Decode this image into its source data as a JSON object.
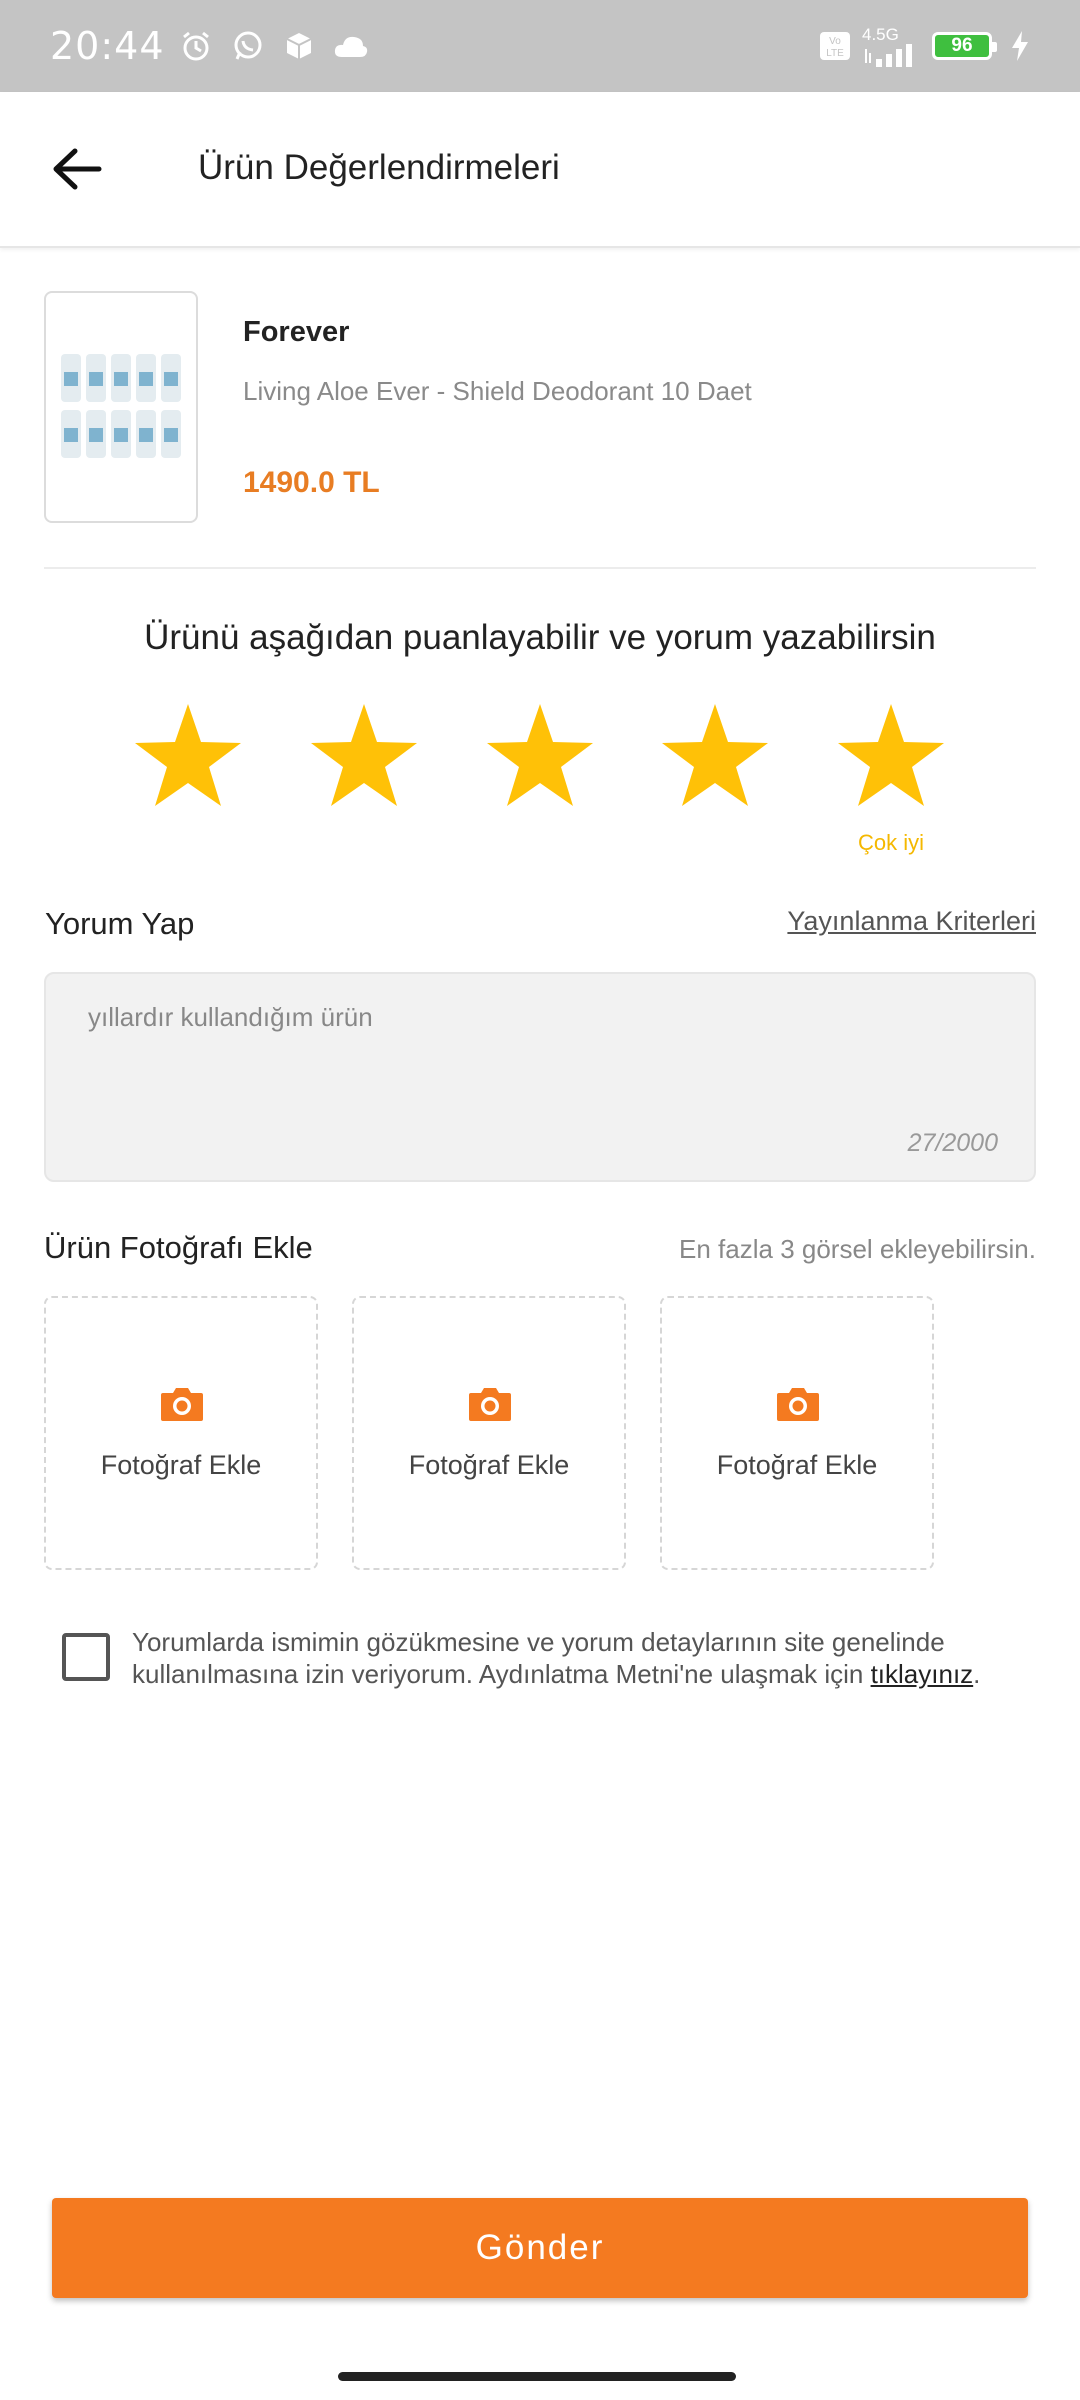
{
  "status_bar": {
    "time": "20:44",
    "network_label": "4.5G",
    "volte_label": "Vo\nLTE",
    "battery": "96",
    "icons": [
      "alarm-icon",
      "whatsapp-icon",
      "package-icon",
      "cloud-icon",
      "volte-icon",
      "signal-icon",
      "battery-icon",
      "charging-icon"
    ]
  },
  "app_bar": {
    "title": "Ürün Değerlendirmeleri",
    "back_icon": "back-arrow-icon"
  },
  "product": {
    "brand": "Forever",
    "name": "Living Aloe Ever - Shield Deodorant 10 Daet",
    "price": "1490.0 TL"
  },
  "rating": {
    "prompt": "Ürünü aşağıdan puanlayabilir ve yorum yazabilirsin",
    "value": 5,
    "max": 5,
    "label": "Çok iyi",
    "star_color": "#FFC107"
  },
  "comment": {
    "title": "Yorum Yap",
    "criteria_link": "Yayınlanma Kriterleri",
    "text": "yıllardır kullandığım ürün",
    "counter": "27/2000"
  },
  "photos": {
    "title": "Ürün Fotoğrafı Ekle",
    "hint": "En fazla 3 görsel ekleyebilirsin.",
    "slots": [
      {
        "label": "Fotoğraf Ekle",
        "icon": "camera-icon"
      },
      {
        "label": "Fotoğraf Ekle",
        "icon": "camera-icon"
      },
      {
        "label": "Fotoğraf Ekle",
        "icon": "camera-icon"
      }
    ]
  },
  "consent": {
    "text": "Yorumlarda ismimin gözükmesine ve yorum detaylarının site genelinde kullanılmasına izin veriyorum. Aydınlatma Metni'ne ulaşmak için ",
    "link": "tıklayınız",
    "suffix": ".",
    "checked": false
  },
  "submit": {
    "label": "Gönder"
  },
  "colors": {
    "accent": "#F47A20",
    "price": "#E87D23",
    "star": "#FFC107",
    "status_bar": "#C4C4C4"
  }
}
